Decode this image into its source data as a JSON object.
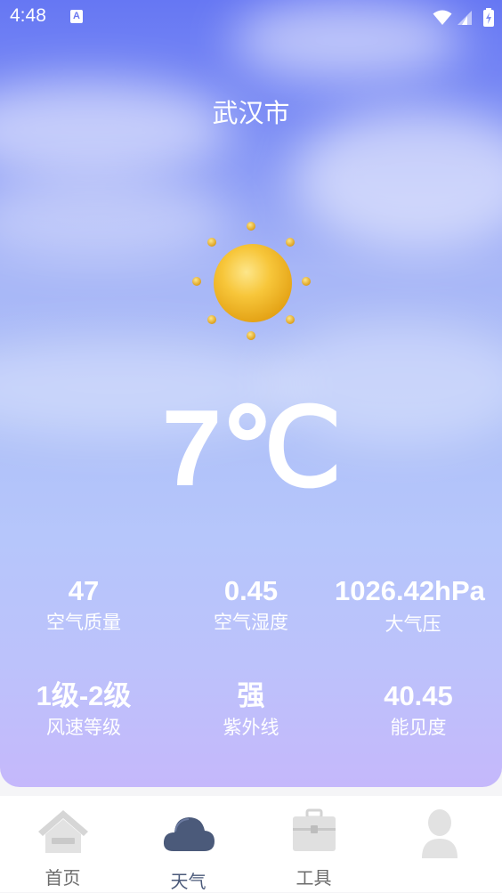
{
  "status_bar": {
    "time": "4:48",
    "notification_icon": "A"
  },
  "weather": {
    "city": "武汉市",
    "condition_icon": "sun-icon",
    "temperature": "7℃"
  },
  "stats": [
    {
      "value": "47",
      "label": "空气质量"
    },
    {
      "value": "0.45",
      "label": "空气湿度"
    },
    {
      "value": "1026.42hPa",
      "label": "大气压"
    },
    {
      "value": "1级-2级",
      "label": "风速等级"
    },
    {
      "value": "强",
      "label": "紫外线"
    },
    {
      "value": "40.45",
      "label": "能见度"
    }
  ],
  "nav": [
    {
      "label": "首页",
      "icon": "home-icon"
    },
    {
      "label": "天气",
      "icon": "cloud-icon",
      "active": true
    },
    {
      "label": "工具",
      "icon": "toolbox-icon"
    },
    {
      "label": "",
      "icon": "user-icon"
    }
  ],
  "colors": {
    "sky_top": "#6677f3",
    "sky_bottom": "#c5b8fb",
    "sun": "#f3c21c",
    "nav_active": "#4b5a7a"
  }
}
